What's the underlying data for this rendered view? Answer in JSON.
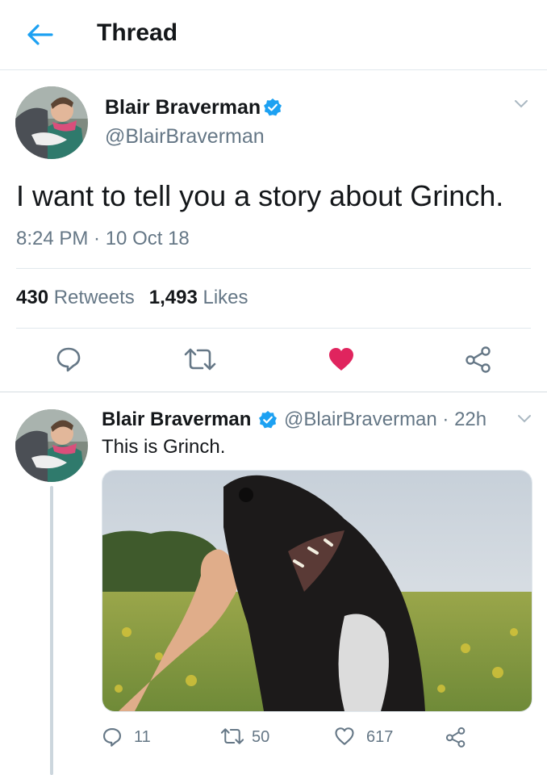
{
  "header": {
    "title": "Thread",
    "back_icon": "arrow-left-icon"
  },
  "colors": {
    "accent": "#1da1f2",
    "like": "#e0245e",
    "secondary": "#657786",
    "divider": "#e1e8ed"
  },
  "main_tweet": {
    "name": "Blair Braverman",
    "handle": "@BlairBraverman",
    "text": "I want to tell you a story about Grinch.",
    "timestamp": "8:24 PM · 10 Oct 18",
    "retweets_count": "430",
    "retweets_label": "Retweets",
    "likes_count": "1,493",
    "likes_label": "Likes",
    "liked": true
  },
  "reply_tweet": {
    "name": "Blair Braverman",
    "handle": "@BlairBraverman · 22h",
    "text": "This is Grinch.",
    "reply_count": "11",
    "retweet_count": "50",
    "like_count": "617"
  }
}
